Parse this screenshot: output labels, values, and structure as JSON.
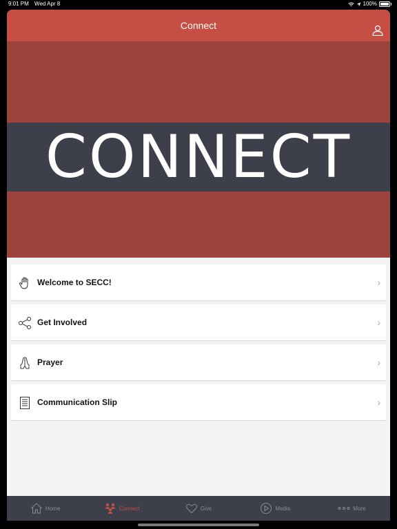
{
  "status_bar": {
    "time": "9:01 PM",
    "date": "Wed Apr 8",
    "battery": "100%"
  },
  "nav": {
    "title": "Connect",
    "profile_icon": "person-icon"
  },
  "hero": {
    "word": "CONNECT"
  },
  "list": [
    {
      "label": "Welcome to SECC!",
      "icon": "hand-icon"
    },
    {
      "label": "Get Involved",
      "icon": "share-icon"
    },
    {
      "label": "Prayer",
      "icon": "prayer-hands-icon"
    },
    {
      "label": "Communication Slip",
      "icon": "document-icon"
    }
  ],
  "tabs": [
    {
      "label": "Home",
      "icon": "home-icon"
    },
    {
      "label": "Connect",
      "icon": "people-icon",
      "active": true
    },
    {
      "label": "Give",
      "icon": "heart-icon"
    },
    {
      "label": "Media",
      "icon": "play-icon"
    },
    {
      "label": "More",
      "icon": "more-icon"
    }
  ],
  "colors": {
    "brand": "#c64f45",
    "hero": "#9b433c",
    "dark": "#3d3f4b"
  }
}
